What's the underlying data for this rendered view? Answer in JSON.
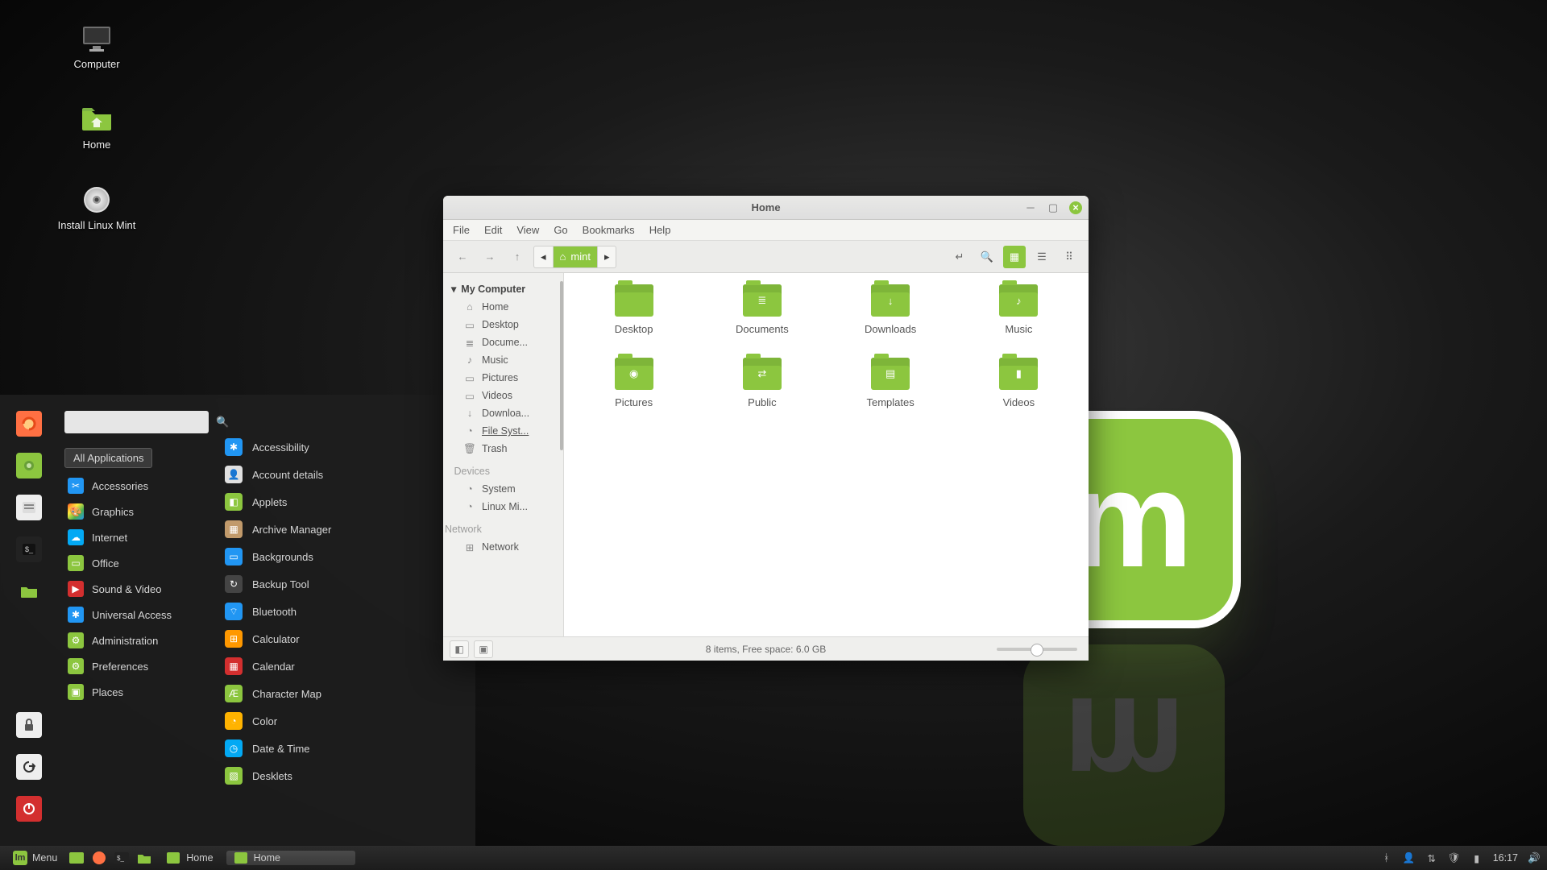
{
  "desktop": {
    "icons": [
      {
        "label": "Computer",
        "kind": "monitor"
      },
      {
        "label": "Home",
        "kind": "folder"
      },
      {
        "label": "Install Linux Mint",
        "kind": "disc"
      }
    ]
  },
  "startmenu": {
    "search_placeholder": "",
    "all_apps": "All Applications",
    "left_buttons": [
      "firefox",
      "software",
      "files",
      "terminal",
      "folder",
      "",
      "lock",
      "logout",
      "power"
    ],
    "categories": [
      {
        "label": "Accessories",
        "color": "#2196f3",
        "glyph": "✂"
      },
      {
        "label": "Graphics",
        "color": "linear",
        "glyph": "🎨"
      },
      {
        "label": "Internet",
        "color": "#03a9f4",
        "glyph": "☁"
      },
      {
        "label": "Office",
        "color": "#8cc63f",
        "glyph": "▭"
      },
      {
        "label": "Sound & Video",
        "color": "#d32f2f",
        "glyph": "▶"
      },
      {
        "label": "Universal Access",
        "color": "#2196f3",
        "glyph": "✱"
      },
      {
        "label": "Administration",
        "color": "#8cc63f",
        "glyph": "⚙"
      },
      {
        "label": "Preferences",
        "color": "#8cc63f",
        "glyph": "⚙"
      },
      {
        "label": "Places",
        "color": "#8cc63f",
        "glyph": "▣"
      }
    ],
    "apps": [
      {
        "label": "Accessibility",
        "color": "#2196f3",
        "glyph": "✱"
      },
      {
        "label": "Account details",
        "color": "#e0e0e0",
        "glyph": "👤"
      },
      {
        "label": "Applets",
        "color": "#8cc63f",
        "glyph": "◧"
      },
      {
        "label": "Archive Manager",
        "color": "#c19a6b",
        "glyph": "▦"
      },
      {
        "label": "Backgrounds",
        "color": "#2196f3",
        "glyph": "▭"
      },
      {
        "label": "Backup Tool",
        "color": "#444",
        "glyph": "↻"
      },
      {
        "label": "Bluetooth",
        "color": "#2196f3",
        "glyph": "⌔"
      },
      {
        "label": "Calculator",
        "color": "#ff9800",
        "glyph": "⊞"
      },
      {
        "label": "Calendar",
        "color": "#d32f2f",
        "glyph": "▦"
      },
      {
        "label": "Character Map",
        "color": "#8cc63f",
        "glyph": "Æ"
      },
      {
        "label": "Color",
        "color": "#ffb300",
        "glyph": "◔"
      },
      {
        "label": "Date & Time",
        "color": "#03a9f4",
        "glyph": "◷"
      },
      {
        "label": "Desklets",
        "color": "#8cc63f",
        "glyph": "▧"
      }
    ]
  },
  "filemanager": {
    "title": "Home",
    "menu": [
      "File",
      "Edit",
      "View",
      "Go",
      "Bookmarks",
      "Help"
    ],
    "path_label": "mint",
    "sidebar": {
      "header": "My Computer",
      "items": [
        "Home",
        "Desktop",
        "Docume...",
        "Music",
        "Pictures",
        "Videos",
        "Downloa...",
        "File Syst...",
        "Trash"
      ],
      "dev_header": "Devices",
      "dev_items": [
        "System",
        "Linux Mi..."
      ],
      "net_header": "Network",
      "net_items": [
        "Network"
      ]
    },
    "folders": [
      {
        "label": "Desktop",
        "glyph": ""
      },
      {
        "label": "Documents",
        "glyph": "≣"
      },
      {
        "label": "Downloads",
        "glyph": "↓"
      },
      {
        "label": "Music",
        "glyph": "♪"
      },
      {
        "label": "Pictures",
        "glyph": "◉"
      },
      {
        "label": "Public",
        "glyph": "⇄"
      },
      {
        "label": "Templates",
        "glyph": "▤"
      },
      {
        "label": "Videos",
        "glyph": "▮"
      }
    ],
    "status": "8 items, Free space: 6.0 GB"
  },
  "taskbar": {
    "menu_label": "Menu",
    "tasks": [
      {
        "label": "Home",
        "active": false
      },
      {
        "label": "Home",
        "active": true
      }
    ],
    "clock": "16:17"
  }
}
